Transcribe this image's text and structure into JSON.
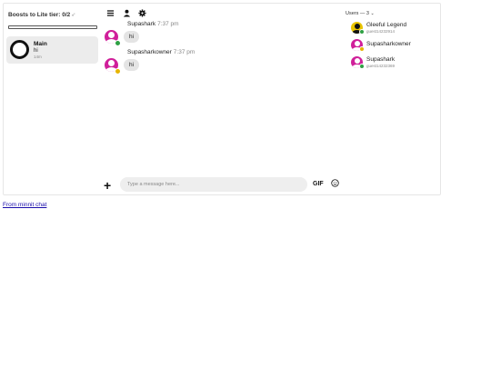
{
  "boost": {
    "label": "Boosts to Lite tier:",
    "count": "0/2",
    "icon": "rocket-icon",
    "progress_fraction": 0
  },
  "rooms": [
    {
      "name": "Main",
      "last_message": "hi",
      "time": "14m"
    }
  ],
  "toolbar": {
    "icons": [
      "menu-icon",
      "user-icon",
      "gear-icon"
    ]
  },
  "messages": [
    {
      "author": "Supashark",
      "time": "7:37 pm",
      "text": "hi",
      "status": "online"
    },
    {
      "author": "Supasharkowner",
      "time": "7:37 pm",
      "text": "hi",
      "status": "away"
    }
  ],
  "composer": {
    "plus": "+",
    "placeholder": "Type a message here...",
    "gif": "GIF",
    "emoji_icon": "smile-icon"
  },
  "users": {
    "title": "Users — 3",
    "list": [
      {
        "name": "Gleeful Legend",
        "sub": "guest14232914",
        "avatar_color": "#e9c400",
        "status": "online"
      },
      {
        "name": "Supasharkowner",
        "sub": "",
        "avatar_color": "#d01f9a",
        "status": "away"
      },
      {
        "name": "Supashark",
        "sub": "guest14232369",
        "avatar_color": "#d01f9a",
        "status": "online"
      }
    ]
  },
  "footer": {
    "link_text": "From minnit chat"
  },
  "colors": {
    "accent_pink": "#d01f9a",
    "online": "#2ea043",
    "away": "#e6b400",
    "bubble": "#e4e4e4"
  }
}
